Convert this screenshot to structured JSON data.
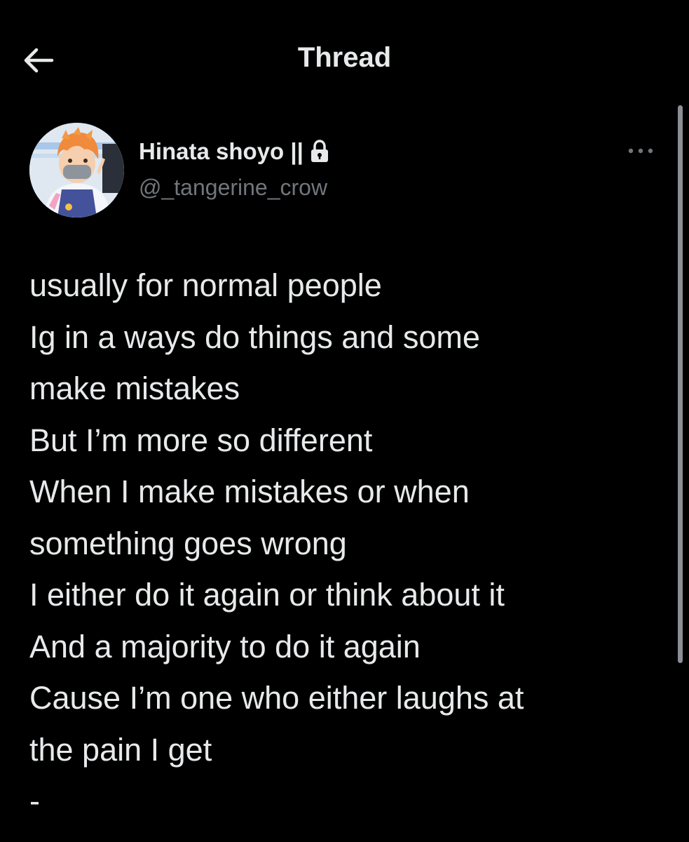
{
  "header": {
    "title": "Thread",
    "back_icon": "arrow-left-icon"
  },
  "author": {
    "display_name": "Hinata shoyo ||",
    "username": "@_tangerine_crow",
    "protected_icon": "lock-icon",
    "more_icon": "more-horizontal-icon"
  },
  "tweet": {
    "lines": [
      "usually for normal people",
      "Ig in a ways do things and some",
      "make mistakes",
      "But I’m more so different",
      "When I make mistakes or when",
      "something goes wrong",
      "I either do it again or think about it",
      "And a majority to do it again",
      "Cause I’m one who either laughs at",
      "the pain I get",
      "-"
    ]
  },
  "colors": {
    "background": "#000000",
    "primary_text": "#e7e9ea",
    "secondary_text": "#71767b",
    "scrollbar": "#8b8f93"
  }
}
